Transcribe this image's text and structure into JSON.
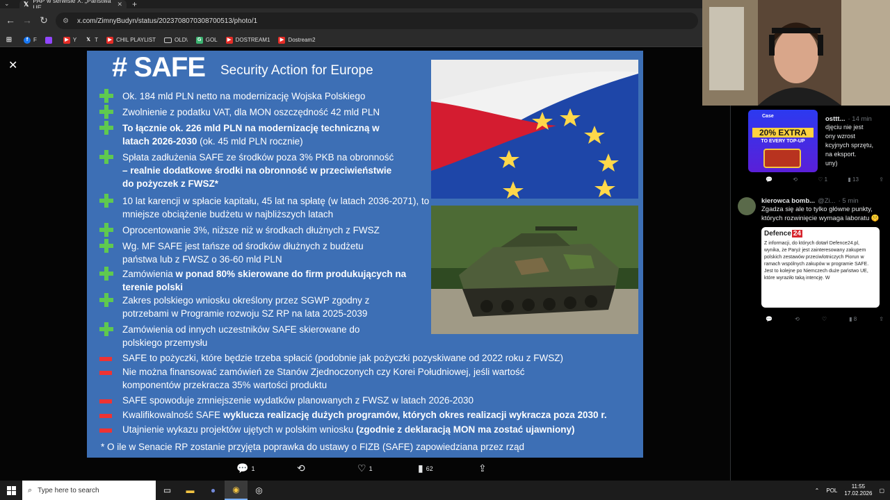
{
  "browser": {
    "tab_title": "PAP w serwisie X: „Państwa UE",
    "url": "x.com/ZimnyBudyn/status/2023708070308700513/photo/1",
    "bookmarks": [
      "F",
      "",
      "Y",
      "T",
      "CHIL PLAYLIST",
      "OLD\\",
      "GOL",
      "DOSTREAM1",
      "Dostream2"
    ]
  },
  "slide": {
    "title": "# SAFE",
    "subtitle": "Security Action for Europe",
    "pros": [
      {
        "text": "Ok. 184 mld PLN netto na modernizację Wojska Polskiego"
      },
      {
        "text": "Zwolnienie z podatku VAT, dla MON oszczędność 42 mld PLN"
      },
      {
        "bold": "To łącznie ok. 226 mld PLN na modernizację techniczną w latach 2026-2030",
        "text": " (ok. 45 mld PLN rocznie)"
      },
      {
        "text": "Spłata zadłużenia SAFE ze środków poza 3% PKB na obronność ",
        "bold": "– realnie dodatkowe środki na obronność w przeciwieństwie do pożyczek z FWSZ*"
      },
      {
        "text": "10 lat karencji w spłacie kapitału, 45 lat na spłatę (w latach 2036-2071), to mniejsze obciążenie budżetu w najbliższych latach"
      },
      {
        "text": "Oprocentowanie 3%, niższe niż w środkach dłużnych z FWSZ"
      },
      {
        "text": "Wg. MF SAFE jest tańsze od środków dłużnych z budżetu państwa lub z FWSZ o 36-60 mld PLN"
      },
      {
        "text": "Zamówienia ",
        "bold": "w ponad 80% skierowane do firm produkujących na terenie polski"
      },
      {
        "text": "Zakres polskiego wniosku określony przez SGWP zgodny z potrzebami w Programie rozwoju SZ RP na lata 2025-2039"
      },
      {
        "text": "Zamówienia od innych uczestników SAFE skierowane do polskiego przemysłu"
      }
    ],
    "cons": [
      {
        "text": "SAFE to pożyczki, które będzie trzeba spłacić (podobnie jak pożyczki pozyskiwane od 2022 roku z FWSZ)"
      },
      {
        "text": "Nie można finansować zamówień ze Stanów Zjednoczonych czy Korei Południowej, jeśli wartość komponentów przekracza 35% wartości produktu"
      },
      {
        "text": "SAFE spowoduje zmniejszenie wydatków planowanych z FWSZ w latach 2026-2030"
      },
      {
        "text": "Kwalifikowalność SAFE ",
        "bold": "wyklucza realizację dużych programów, których okres realizacji wykracza poza 2030 r."
      },
      {
        "text": "Utajnienie wykazu projektów ujętych w polskim wniosku ",
        "bold": "(zgodnie z deklaracją MON ma zostać ujawniony)"
      }
    ],
    "footnote": "* O ile w Senacie RP zostanie przyjęta poprawka do ustawy o FIZB (SAFE) zapowiedziana przez rząd"
  },
  "tweet_actions": {
    "replies": "1",
    "reposts": "",
    "likes": "1",
    "views": "62"
  },
  "ad": {
    "brand": "Case",
    "main": "20% EXTRA",
    "sub": "TO EVERY TOP-UP"
  },
  "replies": [
    {
      "name": "osttt...",
      "time": "· 14 min",
      "body": "djęciu nie jest\nony wzrost\nkcyjnych sprzętu,\nna eksport.\nuny)",
      "stats": {
        "replies": "",
        "reposts": "",
        "likes": "1",
        "views": "13"
      }
    },
    {
      "name": "kierowca bomb...",
      "handle": "@Zi...",
      "time": "· 5 min",
      "body": "Zgadza się ale to tylko główne punkty, których rozwinięcie wymaga laboratu 🤫",
      "card_brand": "Defence",
      "card_brand_num": "24",
      "card_text": "Z informacji, do których dotarł Defence24.pl, wynika, że Paryż jest zainteresowany zakupem polskich zestawów przeciwlotniczych Piorun w ramach wspólnych zakupów w programie SAFE. Jest to kolejne po Niemczech duże państwo UE, które wyraziło taką intencję. W",
      "stats": {
        "replies": "",
        "reposts": "",
        "likes": "",
        "views": "8"
      }
    }
  ],
  "taskbar": {
    "search_placeholder": "Type here to search",
    "lang": "POL",
    "time": "11:55",
    "date": "17.02.2026"
  },
  "colors": {
    "slide_bg": "#3d6fb5",
    "plus": "#5fc94f",
    "minus": "#e33333"
  }
}
